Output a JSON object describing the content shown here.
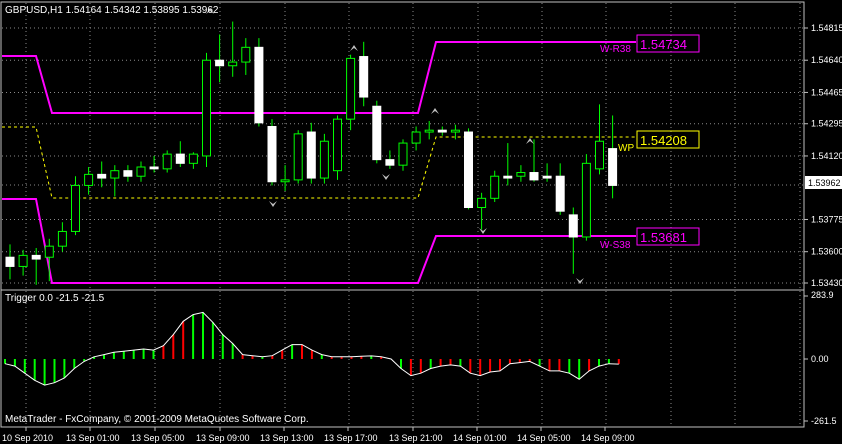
{
  "main_chart": {
    "title": "GBPUSD,H1  1.54164 1.54342 1.53895 1.53962",
    "price_ticks": [
      "1.54815",
      "1.54640",
      "1.54465",
      "1.54295",
      "1.54120",
      "1.53962",
      "1.53775",
      "1.53600",
      "1.53430"
    ],
    "current_price": "1.53962",
    "level_labels": {
      "r38_text": "W-R38",
      "r38_value": "1.54734",
      "wp_text": "WP",
      "wp_value": "1.54208",
      "s38_text": "W-S38",
      "s38_value": "1.53681"
    }
  },
  "indicator": {
    "title": "Trigger 0.0 -21.5 -21.5",
    "ticks": [
      "283.9",
      "0.00",
      "-261.5"
    ]
  },
  "time_axis": [
    "10 Sep 2010",
    "13 Sep 01:00",
    "13 Sep 05:00",
    "13 Sep 09:00",
    "13 Sep 13:00",
    "13 Sep 17:00",
    "13 Sep 21:00",
    "14 Sep 01:00",
    "14 Sep 05:00",
    "14 Sep 09:00"
  ],
  "copyright": "MetaTrader - FxCompany, © 2001-2009 MetaQuotes Software Corp.",
  "colors": {
    "background": "#000000",
    "frame": "#c0c0c0",
    "grid": "#8a8a8a",
    "pivot_bands": "#ff00ff",
    "pivot_mid": "#ffff00",
    "histogram_up": "#00ff00",
    "histogram_down": "#ff0000",
    "trigger_line": "#ffffff"
  },
  "chart_data": {
    "type": "candlestick",
    "symbol": "GBPUSD",
    "timeframe": "H1",
    "ylim": [
      1.5343,
      1.549
    ],
    "candles": [
      {
        "o": 1.5357,
        "h": 1.5364,
        "l": 1.5345,
        "c": 1.5352
      },
      {
        "o": 1.5352,
        "h": 1.5361,
        "l": 1.5347,
        "c": 1.5358
      },
      {
        "o": 1.5358,
        "h": 1.5362,
        "l": 1.5342,
        "c": 1.5356
      },
      {
        "o": 1.5357,
        "h": 1.5367,
        "l": 1.5344,
        "c": 1.5363
      },
      {
        "o": 1.5363,
        "h": 1.5376,
        "l": 1.536,
        "c": 1.5371
      },
      {
        "o": 1.5371,
        "h": 1.5401,
        "l": 1.5369,
        "c": 1.5396
      },
      {
        "o": 1.5396,
        "h": 1.5406,
        "l": 1.5391,
        "c": 1.5402
      },
      {
        "o": 1.5402,
        "h": 1.5409,
        "l": 1.5395,
        "c": 1.54
      },
      {
        "o": 1.54,
        "h": 1.5407,
        "l": 1.539,
        "c": 1.5404
      },
      {
        "o": 1.5404,
        "h": 1.5407,
        "l": 1.5398,
        "c": 1.5401
      },
      {
        "o": 1.5401,
        "h": 1.5409,
        "l": 1.5398,
        "c": 1.5406
      },
      {
        "o": 1.5406,
        "h": 1.5412,
        "l": 1.5403,
        "c": 1.5405
      },
      {
        "o": 1.5405,
        "h": 1.5415,
        "l": 1.5403,
        "c": 1.5413
      },
      {
        "o": 1.5413,
        "h": 1.542,
        "l": 1.5406,
        "c": 1.5408
      },
      {
        "o": 1.5408,
        "h": 1.5414,
        "l": 1.5405,
        "c": 1.5413
      },
      {
        "o": 1.5412,
        "h": 1.5468,
        "l": 1.5406,
        "c": 1.5464
      },
      {
        "o": 1.5464,
        "h": 1.5478,
        "l": 1.5452,
        "c": 1.5461
      },
      {
        "o": 1.5461,
        "h": 1.5485,
        "l": 1.5455,
        "c": 1.5463
      },
      {
        "o": 1.5463,
        "h": 1.5476,
        "l": 1.5456,
        "c": 1.5471
      },
      {
        "o": 1.5471,
        "h": 1.5476,
        "l": 1.5428,
        "c": 1.543
      },
      {
        "o": 1.5428,
        "h": 1.5432,
        "l": 1.5396,
        "c": 1.5398
      },
      {
        "o": 1.5398,
        "h": 1.5407,
        "l": 1.5393,
        "c": 1.5399
      },
      {
        "o": 1.5399,
        "h": 1.5426,
        "l": 1.5397,
        "c": 1.5424
      },
      {
        "o": 1.5425,
        "h": 1.543,
        "l": 1.5397,
        "c": 1.54
      },
      {
        "o": 1.54,
        "h": 1.5424,
        "l": 1.5397,
        "c": 1.542
      },
      {
        "o": 1.5404,
        "h": 1.5434,
        "l": 1.5399,
        "c": 1.5432
      },
      {
        "o": 1.5432,
        "h": 1.5467,
        "l": 1.5426,
        "c": 1.5465
      },
      {
        "o": 1.5466,
        "h": 1.5474,
        "l": 1.5439,
        "c": 1.5444
      },
      {
        "o": 1.5439,
        "h": 1.5442,
        "l": 1.5408,
        "c": 1.541
      },
      {
        "o": 1.541,
        "h": 1.5415,
        "l": 1.5405,
        "c": 1.5407
      },
      {
        "o": 1.5407,
        "h": 1.5421,
        "l": 1.5404,
        "c": 1.5419
      },
      {
        "o": 1.5419,
        "h": 1.5428,
        "l": 1.5415,
        "c": 1.5425
      },
      {
        "o": 1.5425,
        "h": 1.5431,
        "l": 1.5421,
        "c": 1.5426
      },
      {
        "o": 1.5426,
        "h": 1.5428,
        "l": 1.5423,
        "c": 1.5425
      },
      {
        "o": 1.5425,
        "h": 1.5429,
        "l": 1.5421,
        "c": 1.5426
      },
      {
        "o": 1.5425,
        "h": 1.5427,
        "l": 1.5383,
        "c": 1.5384
      },
      {
        "o": 1.5384,
        "h": 1.5392,
        "l": 1.5372,
        "c": 1.5389
      },
      {
        "o": 1.5389,
        "h": 1.5404,
        "l": 1.5387,
        "c": 1.5401
      },
      {
        "o": 1.5401,
        "h": 1.5419,
        "l": 1.5396,
        "c": 1.54
      },
      {
        "o": 1.5401,
        "h": 1.5407,
        "l": 1.5398,
        "c": 1.5403
      },
      {
        "o": 1.5403,
        "h": 1.5421,
        "l": 1.5398,
        "c": 1.5399
      },
      {
        "o": 1.5401,
        "h": 1.5408,
        "l": 1.5398,
        "c": 1.54
      },
      {
        "o": 1.5401,
        "h": 1.5408,
        "l": 1.538,
        "c": 1.5382
      },
      {
        "o": 1.538,
        "h": 1.5384,
        "l": 1.5348,
        "c": 1.5368
      },
      {
        "o": 1.5368,
        "h": 1.5413,
        "l": 1.5366,
        "c": 1.5408
      },
      {
        "o": 1.5405,
        "h": 1.544,
        "l": 1.5402,
        "c": 1.542
      },
      {
        "o": 1.5416,
        "h": 1.5434,
        "l": 1.5389,
        "c": 1.5396
      }
    ],
    "pivot_levels": {
      "W-R38": 1.54734,
      "WP": 1.54208,
      "W-S38": 1.53681
    },
    "trigger_ylim": [
      -261.5,
      283.9
    ],
    "trigger": [
      -20,
      -30,
      -60,
      -90,
      -110,
      -100,
      -80,
      -40,
      -10,
      10,
      20,
      30,
      35,
      40,
      45,
      40,
      60,
      110,
      170,
      200,
      210,
      165,
      110,
      70,
      20,
      15,
      10,
      15,
      40,
      65,
      65,
      40,
      20,
      10,
      10,
      10,
      12,
      14,
      10,
      0,
      -40,
      -70,
      -60,
      -40,
      -30,
      -25,
      -30,
      -60,
      -70,
      -55,
      -50,
      -20,
      -15,
      -10,
      -30,
      -50,
      -50,
      -60,
      -85,
      -50,
      -30,
      -20,
      -21.5
    ],
    "trigger_colors": "dgggggggggggggggrrrgggggrrgrrgrrgrrrrgrrgrrgrrgrrrrrrrgrrggrggrrd"
  }
}
